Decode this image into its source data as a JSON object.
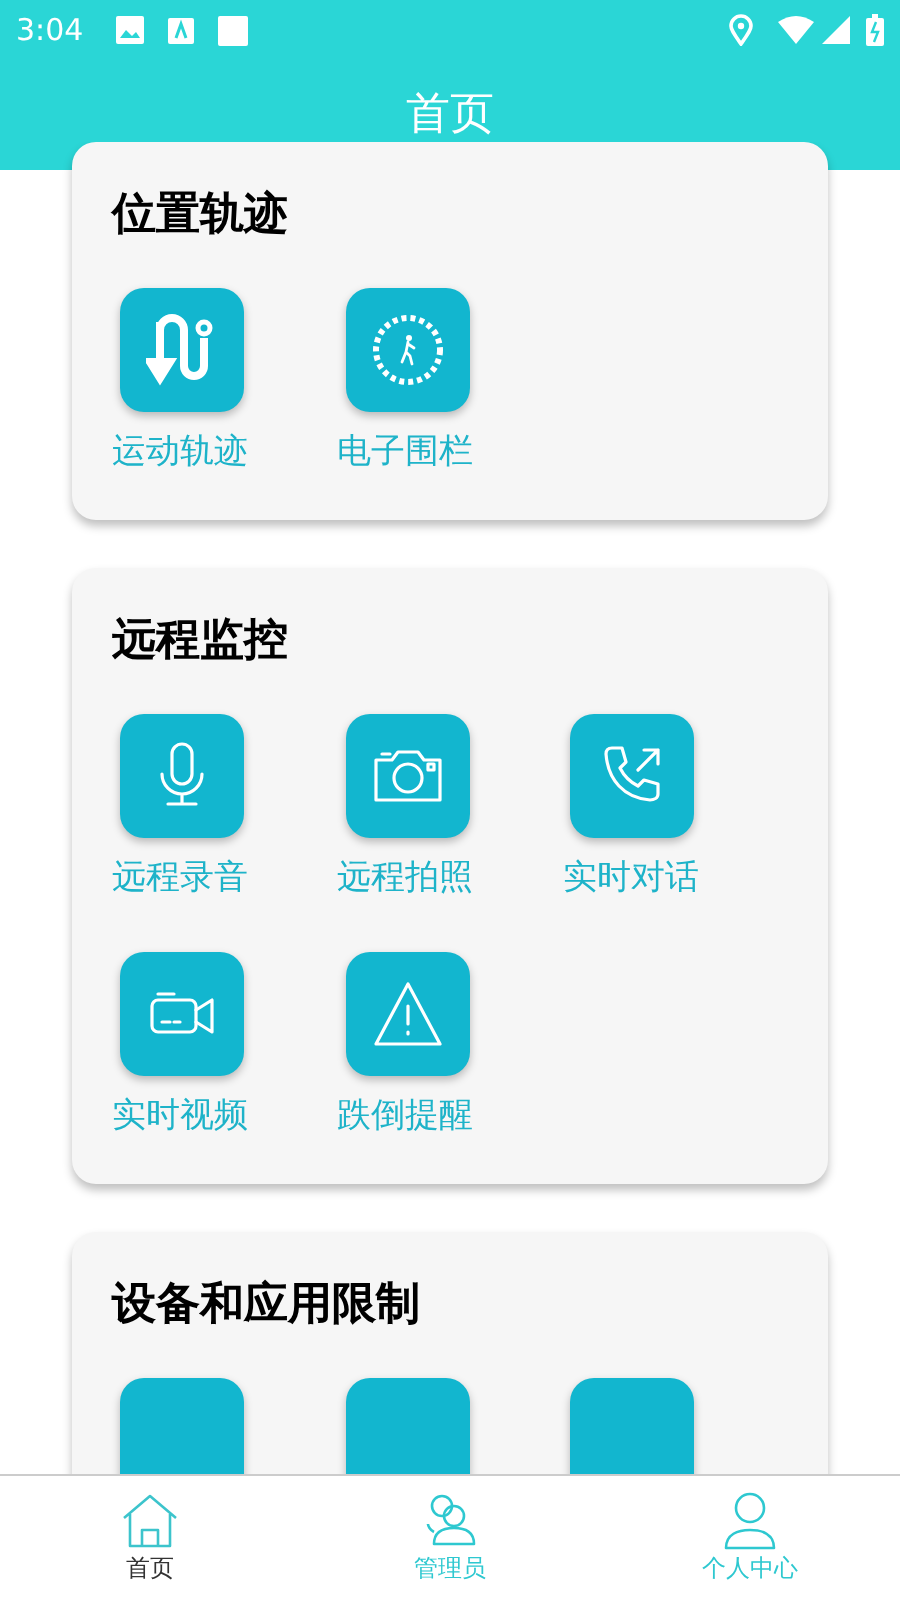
{
  "status_bar": {
    "time": "3:04"
  },
  "header": {
    "title": "首页"
  },
  "sections": [
    {
      "title": "位置轨迹",
      "items": [
        {
          "kind": "route",
          "label": "运动轨迹"
        },
        {
          "kind": "fence",
          "label": "电子围栏"
        }
      ]
    },
    {
      "title": "远程监控",
      "items": [
        {
          "kind": "mic",
          "label": "远程录音"
        },
        {
          "kind": "camera",
          "label": "远程拍照"
        },
        {
          "kind": "call",
          "label": "实时对话"
        },
        {
          "kind": "video",
          "label": "实时视频"
        },
        {
          "kind": "alert",
          "label": "跌倒提醒"
        }
      ]
    },
    {
      "title": "设备和应用限制",
      "items": [
        {
          "kind": "blank"
        },
        {
          "kind": "blank"
        },
        {
          "kind": "blank"
        }
      ]
    }
  ],
  "tab_bar": [
    {
      "kind": "home",
      "label": "首页",
      "selected": true
    },
    {
      "kind": "admin",
      "label": "管理员",
      "selected": false
    },
    {
      "kind": "person",
      "label": "个人中心",
      "selected": false
    }
  ]
}
